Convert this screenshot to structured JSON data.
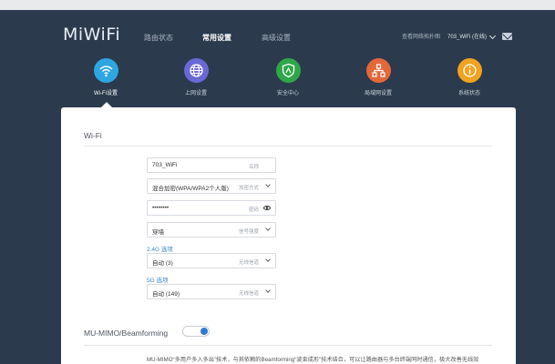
{
  "header": {
    "logo": "MiWiFi",
    "nav": [
      "路由状态",
      "常用设置",
      "高级设置"
    ],
    "active_nav": "常用设置",
    "meta_label": "查看网络拓扑图",
    "ssid": "703_WiFi (在线)"
  },
  "categories": [
    {
      "label": "Wi-Fi设置",
      "color": "#2ea6e0",
      "icon": "wifi-icon"
    },
    {
      "label": "上网设置",
      "color": "#6a68d6",
      "icon": "globe-icon"
    },
    {
      "label": "安全中心",
      "color": "#2fa64a",
      "icon": "shield-icon"
    },
    {
      "label": "局域网设置",
      "color": "#e2683a",
      "icon": "network-icon"
    },
    {
      "label": "系统状态",
      "color": "#f0a320",
      "icon": "info-icon"
    }
  ],
  "wifi": {
    "section_title": "Wi-Fi",
    "name": {
      "value": "703_WiFi",
      "hint": "名称"
    },
    "encryption": {
      "value": "混合加密(WPA/WPA2个人版)",
      "hint": "加密方式"
    },
    "password": {
      "value": "••••••••",
      "hint": "密码"
    },
    "signal": {
      "value": "穿墙",
      "hint": "信号强度"
    },
    "band_24": {
      "label": "2.4G 选项",
      "value": "自动 (3)",
      "hint": "无线信道"
    },
    "band_5": {
      "label": "5G 选项",
      "value": "自动 (149)",
      "hint": "无线信道"
    }
  },
  "mumimo": {
    "section_title": "MU-MIMO/Beamforming",
    "enabled": true,
    "description": "MU-MIMO“多用户多入多出”技术，与其依赖的Beamforming“波束成形”技术结合，可以让路由器与多台终端同时通信，极大改善无线效"
  }
}
